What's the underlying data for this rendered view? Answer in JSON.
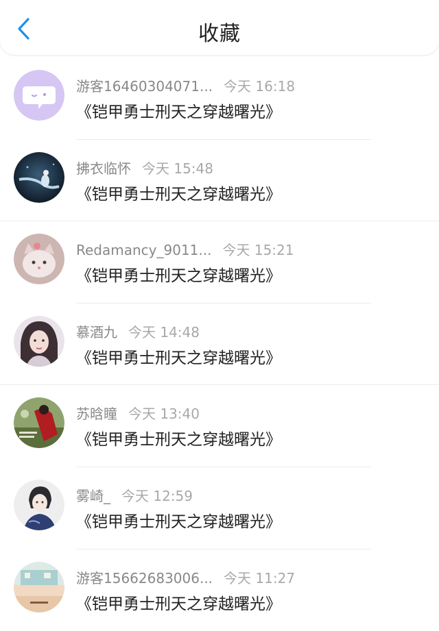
{
  "header": {
    "title": "收藏"
  },
  "colors": {
    "accent": "#1f8fe8",
    "header_bg": "#ffffff"
  },
  "items": [
    {
      "name": "游客16460304071...",
      "time": "今天 16:18",
      "title": "《铠甲勇士刑天之穿越曙光》",
      "avatar": "chat-bubble-icon"
    },
    {
      "name": "拂衣临怀",
      "time": "今天 15:48",
      "title": "《铠甲勇士刑天之穿越曙光》",
      "avatar": "photo"
    },
    {
      "name": "Redamancy_9011...",
      "time": "今天 15:21",
      "title": "《铠甲勇士刑天之穿越曙光》",
      "avatar": "photo"
    },
    {
      "name": "慕酒九",
      "time": "今天 14:48",
      "title": "《铠甲勇士刑天之穿越曙光》",
      "avatar": "photo"
    },
    {
      "name": "苏晗瞳",
      "time": "今天 13:40",
      "title": "《铠甲勇士刑天之穿越曙光》",
      "avatar": "photo"
    },
    {
      "name": "雾崎_",
      "time": "今天 12:59",
      "title": "《铠甲勇士刑天之穿越曙光》",
      "avatar": "photo"
    },
    {
      "name": "游客15662683006...",
      "time": "今天 11:27",
      "title": "《铠甲勇士刑天之穿越曙光》",
      "avatar": "photo"
    }
  ]
}
